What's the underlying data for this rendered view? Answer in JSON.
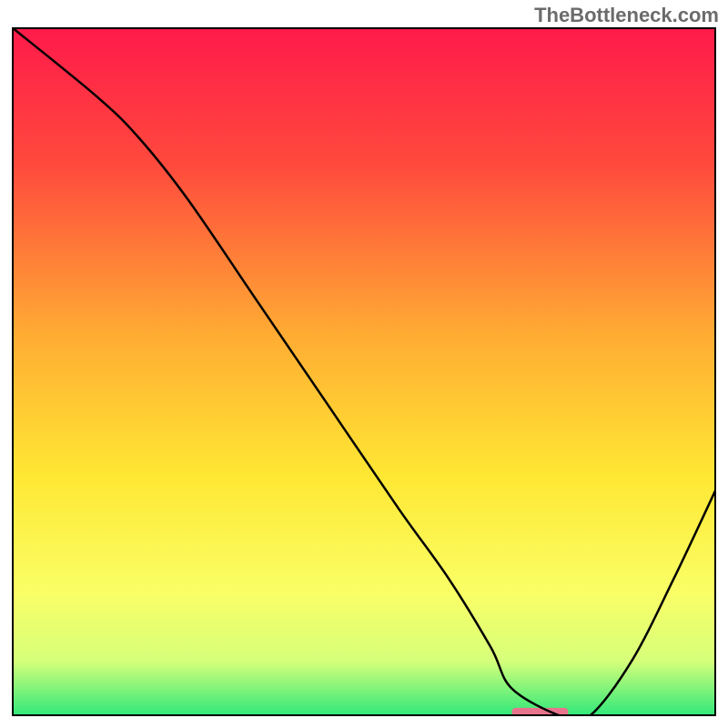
{
  "watermark": "TheBottleneck.com",
  "chart_data": {
    "type": "line",
    "title": "",
    "xlabel": "",
    "ylabel": "",
    "xlim": [
      0,
      100
    ],
    "ylim": [
      0,
      100
    ],
    "background_gradient": {
      "stops": [
        {
          "offset": 0,
          "color": "#ff1a4a"
        },
        {
          "offset": 20,
          "color": "#ff4a3d"
        },
        {
          "offset": 45,
          "color": "#ffad33"
        },
        {
          "offset": 65,
          "color": "#ffe733"
        },
        {
          "offset": 82,
          "color": "#faff66"
        },
        {
          "offset": 92,
          "color": "#d6ff7a"
        },
        {
          "offset": 100,
          "color": "#2ee87a"
        }
      ]
    },
    "series": [
      {
        "name": "bottleneck-curve",
        "color": "#000000",
        "width": 2.5,
        "x": [
          0,
          12,
          18,
          25,
          35,
          45,
          55,
          62,
          68,
          71,
          78,
          82,
          88,
          94,
          100
        ],
        "values": [
          100,
          90,
          84,
          75,
          60,
          45,
          30,
          20,
          10,
          4,
          0,
          0,
          8,
          20,
          33
        ]
      }
    ],
    "marker": {
      "x": 75,
      "y": 0,
      "width": 8,
      "height": 1.2,
      "color": "#e8738c"
    },
    "border": {
      "color": "#000000",
      "width": 2
    }
  }
}
